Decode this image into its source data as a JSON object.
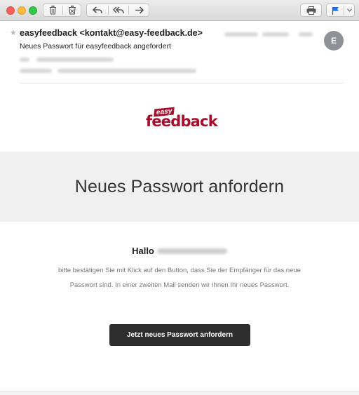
{
  "toolbar": {
    "buttons": [
      "trash",
      "junk",
      "reply",
      "reply-all",
      "forward",
      "print",
      "flag",
      "flag-menu"
    ]
  },
  "message": {
    "star": "★",
    "sender": "easyfeedback <kontakt@easy-feedback.de>",
    "subject": "Neues Passwort für easyfeedback angefordert",
    "avatar_initial": "E"
  },
  "email": {
    "logo_small": "easy",
    "logo_main": "feedback",
    "heading": "Neues Passwort anfordern",
    "greeting": "Hallo",
    "paragraph_line1": "bitte bestätigen Sie mit Klick auf den Button, dass Sie der Empfänger für das neue",
    "paragraph_line2": "Passwort sind. In einer zweiten Mail senden wir Ihnen Ihr neues Passwort.",
    "cta_label": "Jetzt neues Passwort anfordern"
  },
  "colors": {
    "brand": "#a30f2d",
    "band_bg": "#f0f0f0",
    "button_bg": "#2d2d2d",
    "flag_blue": "#1a73e8"
  }
}
